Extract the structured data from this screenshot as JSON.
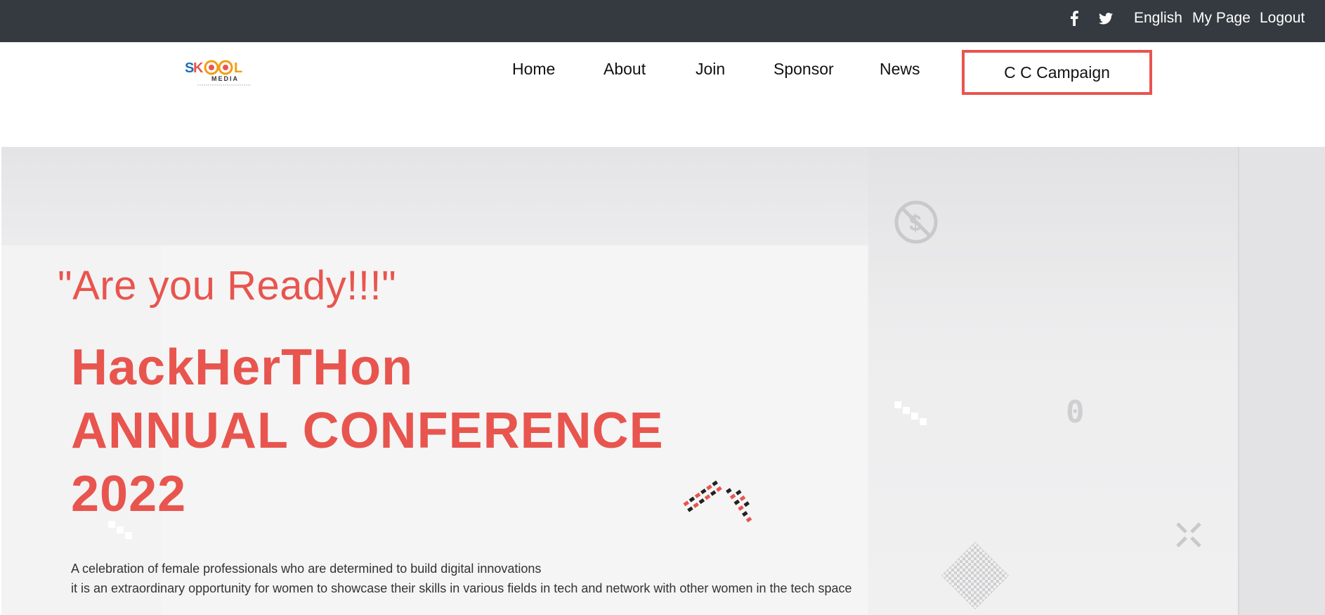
{
  "topbar": {
    "facebook_icon": "facebook-icon",
    "twitter_icon": "twitter-icon",
    "language": "English",
    "my_page": "My Page",
    "logout": "Logout"
  },
  "logo": {
    "text_sk": "SK",
    "text_ool": "OOL",
    "text_media": "MEDIA"
  },
  "nav": {
    "items": [
      {
        "label": "Home"
      },
      {
        "label": "About"
      },
      {
        "label": "Join"
      },
      {
        "label": "Sponsor"
      },
      {
        "label": "News"
      }
    ],
    "cta_label": "C C Campaign"
  },
  "hero": {
    "tagline": "\"Are you Ready!!!\"",
    "headline_lines": [
      "HackHerTHon",
      "ANNUAL CONFERENCE",
      "2022"
    ],
    "description_lines": [
      "A celebration of female professionals who are determined to build digital innovations",
      "it is an extraordinary opportunity for women to showcase their skills in various fields in tech and network with other women in the tech space"
    ]
  },
  "colors": {
    "topbar_bg": "#343a40",
    "accent": "#e8554e",
    "hero_bg": "#f3f3f4",
    "text_dark": "#111111"
  }
}
